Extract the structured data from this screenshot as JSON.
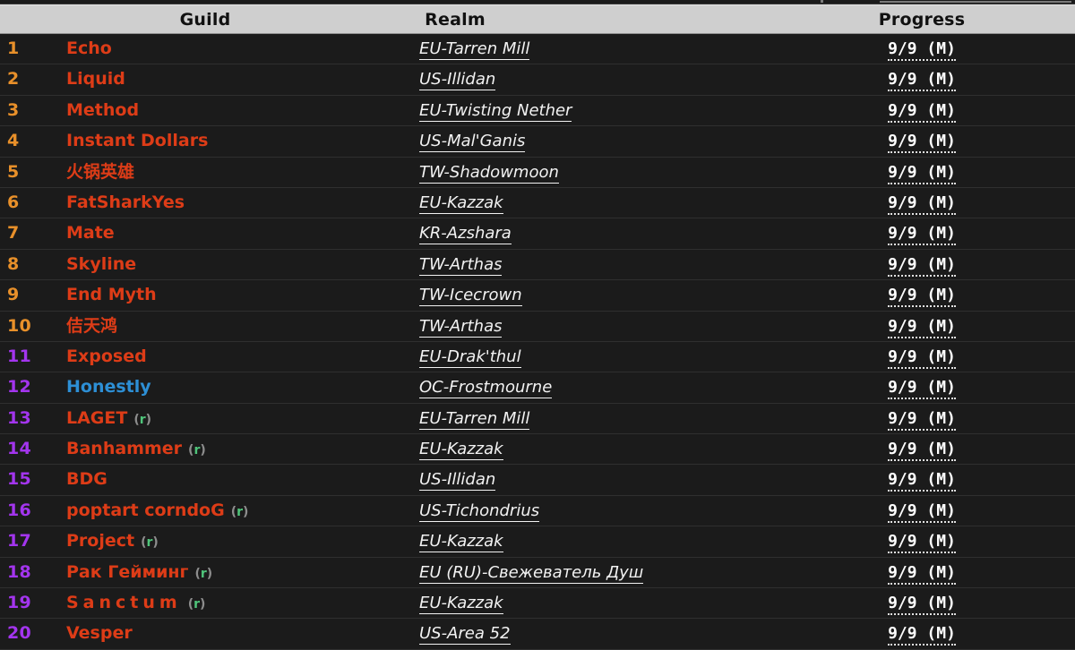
{
  "table": {
    "columns": {
      "rank": "",
      "guild": "Guild",
      "realm": "Realm",
      "progress": "Progress"
    },
    "colors": {
      "rank_top10": "#e8902a",
      "rank_other": "#a335ee",
      "guild_default": "#dd3c17",
      "guild_alt": "#2d8fd5",
      "realm_text": "#f2f2f2",
      "progress_text": "#ffffff",
      "header_background": "#cfcfcf",
      "row_background": "#1b1b1b",
      "page_background": "#181818",
      "recruiting_letter": "#4fc47a"
    },
    "rows": [
      {
        "rank": "1",
        "guild": "Echo",
        "recruiting": "",
        "realm": "EU-Tarren Mill",
        "progress": "9/9 (M)"
      },
      {
        "rank": "2",
        "guild": "Liquid",
        "recruiting": "",
        "realm": "US-Illidan",
        "progress": "9/9 (M)"
      },
      {
        "rank": "3",
        "guild": "Method",
        "recruiting": "",
        "realm": "EU-Twisting Nether",
        "progress": "9/9 (M)"
      },
      {
        "rank": "4",
        "guild": "Instant Dollars",
        "recruiting": "",
        "realm": "US-Mal'Ganis",
        "progress": "9/9 (M)"
      },
      {
        "rank": "5",
        "guild": "火锅英雄",
        "recruiting": "",
        "realm": "TW-Shadowmoon",
        "progress": "9/9 (M)"
      },
      {
        "rank": "6",
        "guild": "FatSharkYes",
        "recruiting": "",
        "realm": "EU-Kazzak",
        "progress": "9/9 (M)"
      },
      {
        "rank": "7",
        "guild": "Mate",
        "recruiting": "",
        "realm": "KR-Azshara",
        "progress": "9/9 (M)"
      },
      {
        "rank": "8",
        "guild": "Skyline",
        "recruiting": "",
        "realm": "TW-Arthas",
        "progress": "9/9 (M)"
      },
      {
        "rank": "9",
        "guild": "End Myth",
        "recruiting": "",
        "realm": "TW-Icecrown",
        "progress": "9/9 (M)"
      },
      {
        "rank": "10",
        "guild": "佶天鸿",
        "recruiting": "",
        "realm": "TW-Arthas",
        "progress": "9/9 (M)"
      },
      {
        "rank": "11",
        "guild": "Exposed",
        "recruiting": "",
        "realm": "EU-Drak'thul",
        "progress": "9/9 (M)"
      },
      {
        "rank": "12",
        "guild": "Honestly",
        "recruiting": "",
        "realm": "OC-Frostmourne",
        "progress": "9/9 (M)"
      },
      {
        "rank": "13",
        "guild": "LAGET",
        "recruiting": "(r)",
        "realm": "EU-Tarren Mill",
        "progress": "9/9 (M)"
      },
      {
        "rank": "14",
        "guild": "Banhammer",
        "recruiting": "(r)",
        "realm": "EU-Kazzak",
        "progress": "9/9 (M)"
      },
      {
        "rank": "15",
        "guild": "BDG",
        "recruiting": "",
        "realm": "US-Illidan",
        "progress": "9/9 (M)"
      },
      {
        "rank": "16",
        "guild": "poptart corndoG",
        "recruiting": "(r)",
        "realm": "US-Tichondrius",
        "progress": "9/9 (M)"
      },
      {
        "rank": "17",
        "guild": "Project",
        "recruiting": "(r)",
        "realm": "EU-Kazzak",
        "progress": "9/9 (M)"
      },
      {
        "rank": "18",
        "guild": "Рак Гейминг",
        "recruiting": "(r)",
        "realm": "EU (RU)-Свежеватель Душ",
        "progress": "9/9 (M)"
      },
      {
        "rank": "19",
        "guild": "Sanctum",
        "recruiting": "(r)",
        "realm": "EU-Kazzak",
        "progress": "9/9 (M)"
      },
      {
        "rank": "20",
        "guild": "Vesper",
        "recruiting": "",
        "realm": "US-Area 52",
        "progress": "9/9 (M)"
      }
    ]
  }
}
